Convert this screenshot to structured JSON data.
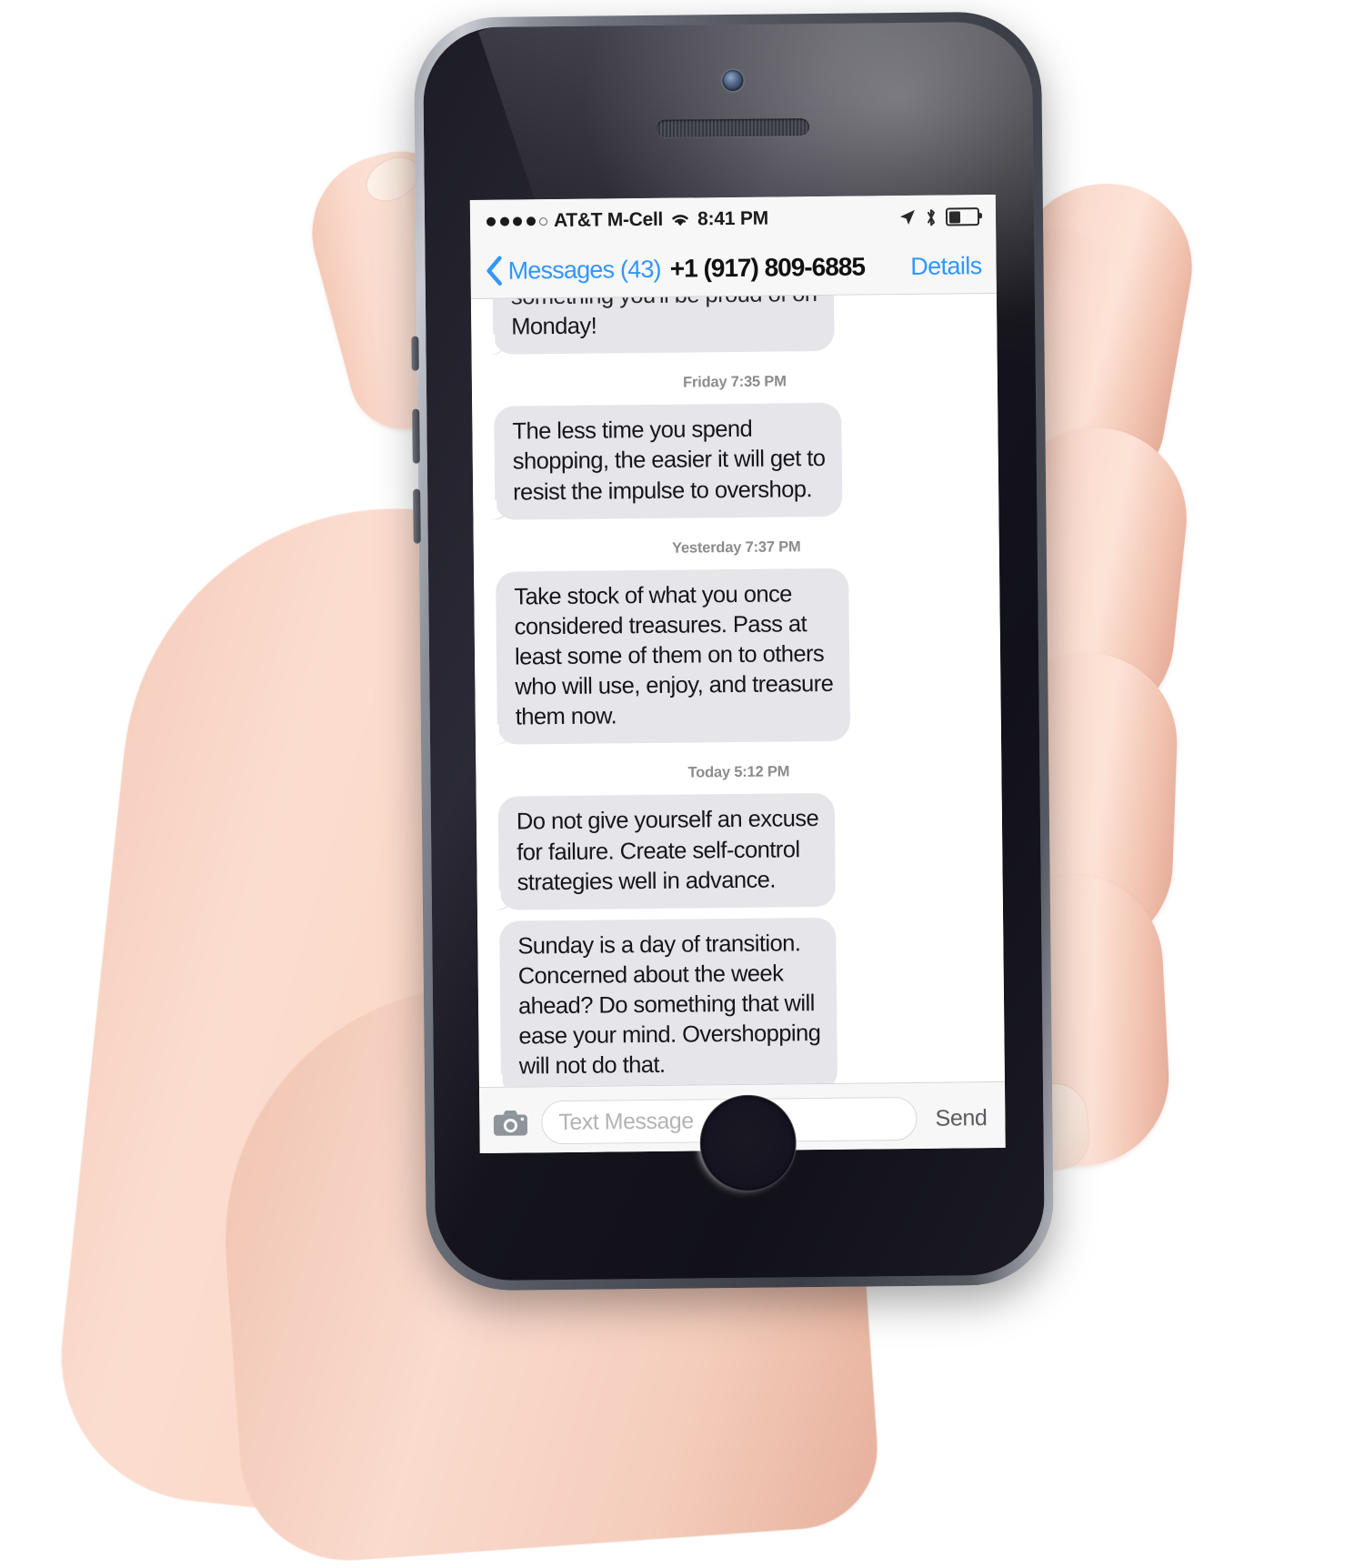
{
  "device": {
    "type": "smartphone",
    "orientation": "portrait",
    "hardware": {
      "camera": "front-camera",
      "earpiece": "earpiece-speaker",
      "home_button": "home-button"
    }
  },
  "status_bar": {
    "signal_dots_filled": 4,
    "signal_dots_total": 5,
    "carrier": "AT&T M-Cell",
    "wifi": "wifi-icon",
    "time": "8:41 PM",
    "location_icon": "location-arrow-icon",
    "bluetooth_icon": "bluetooth-icon",
    "battery_level_pct": 38
  },
  "nav_bar": {
    "back_icon": "chevron-left-icon",
    "back_label": "Messages (43)",
    "title": "+1 (917) 809-6885",
    "details_label": "Details",
    "accent_color": "#3196ff"
  },
  "thread": {
    "bubble_color": "#e5e5ea",
    "text_color": "#16161a",
    "timestamp_color": "#8b8b8b",
    "items": [
      {
        "kind": "bubble",
        "side": "incoming",
        "clipped": true,
        "lines": [
          "something you'll be proud of on",
          "Monday!"
        ]
      },
      {
        "kind": "timestamp",
        "text": "Friday 7:35 PM"
      },
      {
        "kind": "bubble",
        "side": "incoming",
        "clipped": false,
        "lines": [
          "The less time you spend",
          "shopping, the easier it will get to",
          "resist the impulse to overshop."
        ]
      },
      {
        "kind": "timestamp",
        "text": "Yesterday 7:37 PM"
      },
      {
        "kind": "bubble",
        "side": "incoming",
        "clipped": false,
        "lines": [
          "Take stock of what you once",
          "considered treasures. Pass at",
          "least some of them on to others",
          "who will use, enjoy, and treasure",
          "them now."
        ]
      },
      {
        "kind": "timestamp",
        "text": "Today 5:12 PM"
      },
      {
        "kind": "bubble",
        "side": "incoming",
        "clipped": false,
        "lines": [
          "Do not give yourself an excuse",
          "for failure. Create self-control",
          "strategies well in advance."
        ]
      },
      {
        "kind": "bubble",
        "side": "incoming",
        "clipped": false,
        "lines": [
          "Sunday is a day of transition.",
          "Concerned about the week",
          "ahead? Do something that will",
          "ease your mind. Overshopping",
          "will not do that."
        ]
      }
    ]
  },
  "input_bar": {
    "camera_icon": "camera-icon",
    "placeholder": "Text Message",
    "value": "",
    "send_label": "Send"
  }
}
